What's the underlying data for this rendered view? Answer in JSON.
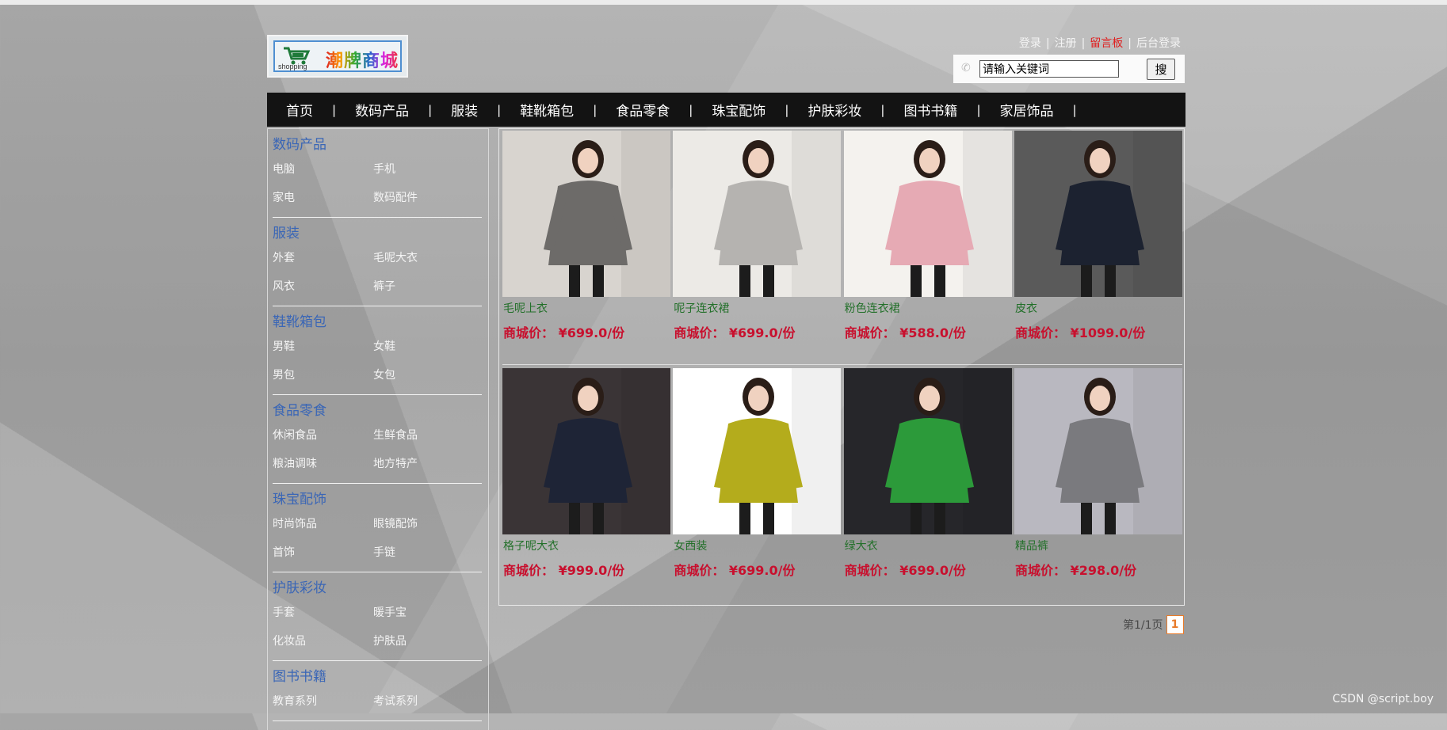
{
  "header": {
    "logo_small_text": "shopping",
    "logo_brand": "潮牌商城",
    "links": [
      "登录",
      "注册",
      "留言板",
      "后台登录"
    ],
    "separator": "|",
    "search_placeholder": "请输入关键词",
    "search_button": "搜"
  },
  "nav": {
    "separator": "|",
    "items": [
      "首页",
      "数码产品",
      "服装",
      "鞋靴箱包",
      "食品零食",
      "珠宝配饰",
      "护肤彩妆",
      "图书书籍",
      "家居饰品"
    ]
  },
  "sidebar": {
    "categories": [
      {
        "title": "数码产品",
        "items": [
          "电脑",
          "手机",
          "家电",
          "数码配件"
        ]
      },
      {
        "title": "服装",
        "items": [
          "外套",
          "毛呢大衣",
          "风衣",
          "裤子"
        ]
      },
      {
        "title": "鞋靴箱包",
        "items": [
          "男鞋",
          "女鞋",
          "男包",
          "女包"
        ]
      },
      {
        "title": "食品零食",
        "items": [
          "休闲食品",
          "生鲜食品",
          "粮油调味",
          "地方特产"
        ]
      },
      {
        "title": "珠宝配饰",
        "items": [
          "时尚饰品",
          "眼镜配饰",
          "首饰",
          "手链"
        ]
      },
      {
        "title": "护肤彩妆",
        "items": [
          "手套",
          "暖手宝",
          "化妆品",
          "护肤品"
        ]
      },
      {
        "title": "图书书籍",
        "items": [
          "教育系列",
          "考试系列"
        ]
      }
    ]
  },
  "products": [
    {
      "name": "毛呢上衣",
      "price": "商城价：  ¥699.0/份",
      "bg": "#d8d4cf",
      "coat": "#6d6b69"
    },
    {
      "name": "呢子连衣裙",
      "price": "商城价：  ¥699.0/份",
      "bg": "#eceae6",
      "coat": "#b5b3b0"
    },
    {
      "name": "粉色连衣裙",
      "price": "商城价：  ¥588.0/份",
      "bg": "#f4f2ee",
      "coat": "#e6aab4"
    },
    {
      "name": "皮衣",
      "price": "商城价：  ¥1099.0/份",
      "bg": "#5a5a5a",
      "coat": "#1c2230"
    },
    {
      "name": "格子呢大衣",
      "price": "商城价：  ¥999.0/份",
      "bg": "#3a3436",
      "coat": "#1e2436"
    },
    {
      "name": "女西装",
      "price": "商城价：  ¥699.0/份",
      "bg": "#ffffff",
      "coat": "#b4ac1c"
    },
    {
      "name": "绿大衣",
      "price": "商城价：  ¥699.0/份",
      "bg": "#26262a",
      "coat": "#2c9a3a"
    },
    {
      "name": "精品裤",
      "price": "商城价：  ¥298.0/份",
      "bg": "#b9b8c0",
      "coat": "#7a7a7e"
    }
  ],
  "pager": {
    "label": "第1/1页",
    "current": "1"
  },
  "watermark": "CSDN @script.boy"
}
